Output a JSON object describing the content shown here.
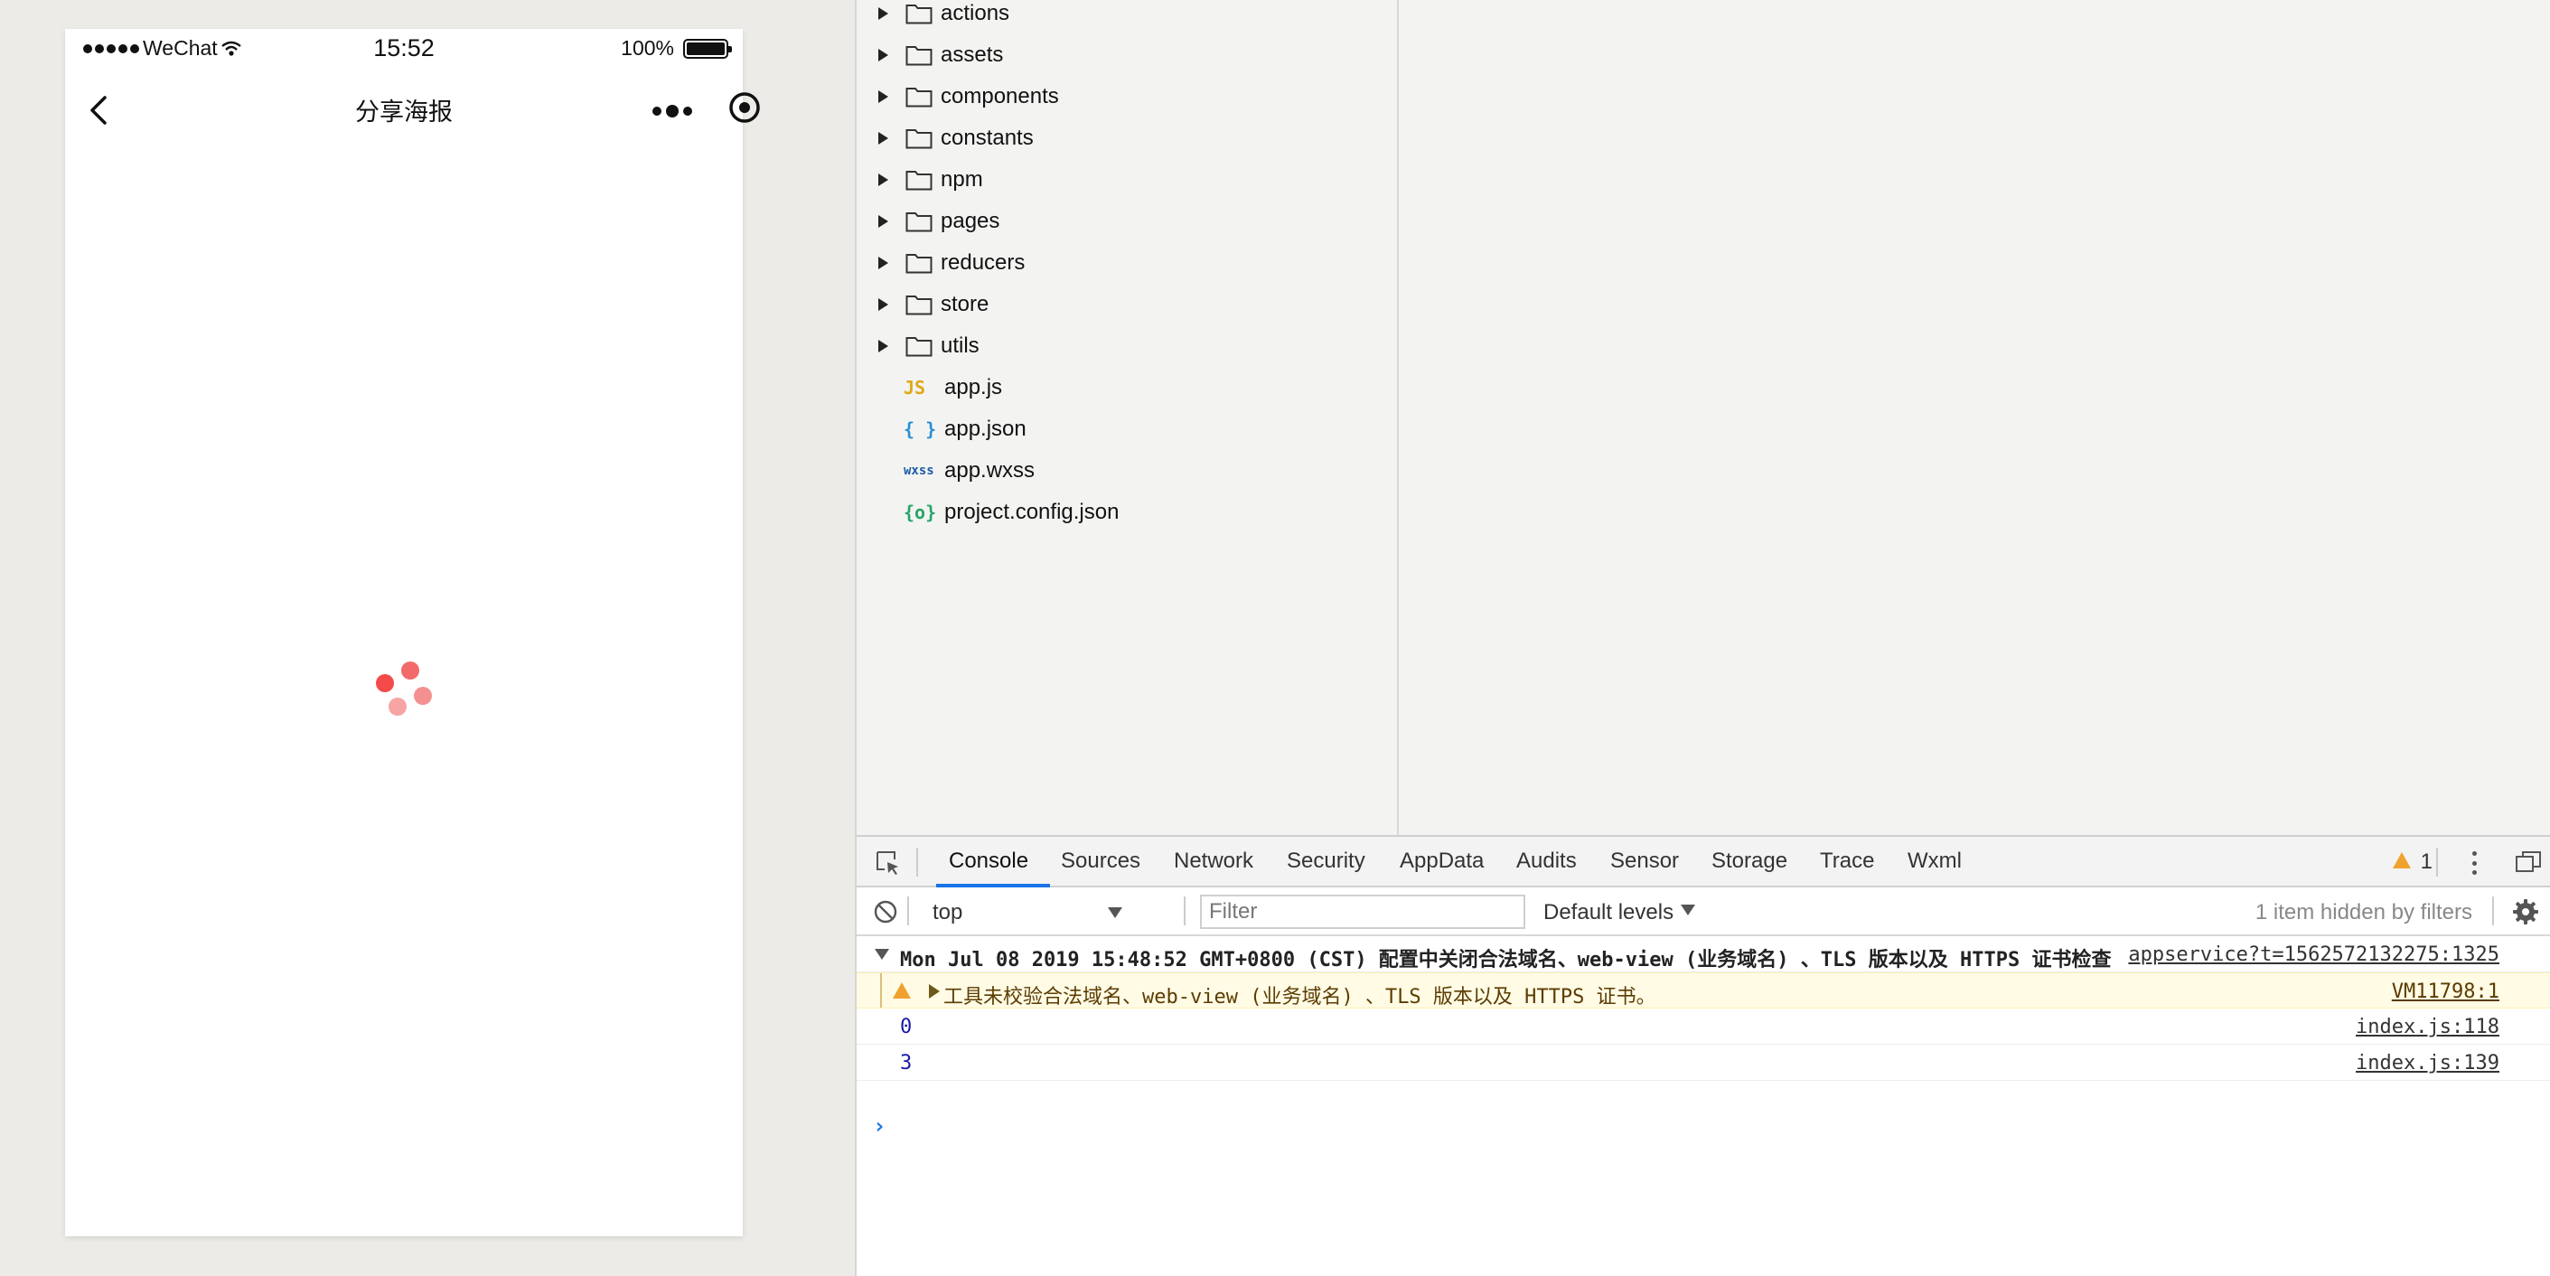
{
  "simulator": {
    "status_bar": {
      "carrier": "WeChat",
      "time": "15:52",
      "battery": "100%"
    },
    "nav": {
      "title": "分享海报"
    },
    "loader_colors": [
      "#f44a4a",
      "#f26a6a",
      "#f59090",
      "#f7a4a4"
    ]
  },
  "file_tree": {
    "folders": [
      "actions",
      "assets",
      "components",
      "constants",
      "npm",
      "pages",
      "reducers",
      "store",
      "utils"
    ],
    "files": [
      {
        "icon": "JS",
        "name": "app.js",
        "icon_color": "#e0a91a"
      },
      {
        "icon": "{ }",
        "name": "app.json",
        "icon_color": "#2a8fd4"
      },
      {
        "icon": "wxss",
        "name": "app.wxss",
        "icon_color": "#1e5aa8"
      },
      {
        "icon": "{o}",
        "name": "project.config.json",
        "icon_color": "#27a567"
      }
    ]
  },
  "devtools": {
    "tabs": [
      "Console",
      "Sources",
      "Network",
      "Security",
      "AppData",
      "Audits",
      "Sensor",
      "Storage",
      "Trace",
      "Wxml"
    ],
    "active_tab": "Console",
    "warning_count": "1",
    "toolbar": {
      "context": "top",
      "filter_placeholder": "Filter",
      "levels": "Default levels",
      "hidden_note": "1 item hidden by filters"
    },
    "console": {
      "group": {
        "message": "Mon Jul 08 2019 15:48:52 GMT+0800 (CST) 配置中关闭合法域名、web-view (业务域名) 、TLS 版本以及 HTTPS 证书检查",
        "source": "appservice?t=1562572132275:1325"
      },
      "warning": {
        "message": "工具未校验合法域名、web-view (业务域名) 、TLS 版本以及 HTTPS 证书。",
        "source": "VM11798:1"
      },
      "logs": [
        {
          "value": "0",
          "source": "index.js:118"
        },
        {
          "value": "3",
          "source": "index.js:139"
        }
      ],
      "prompt": "›"
    }
  },
  "colors": {
    "accent_blue": "#1a73e8",
    "warning": "#f0a22e"
  }
}
